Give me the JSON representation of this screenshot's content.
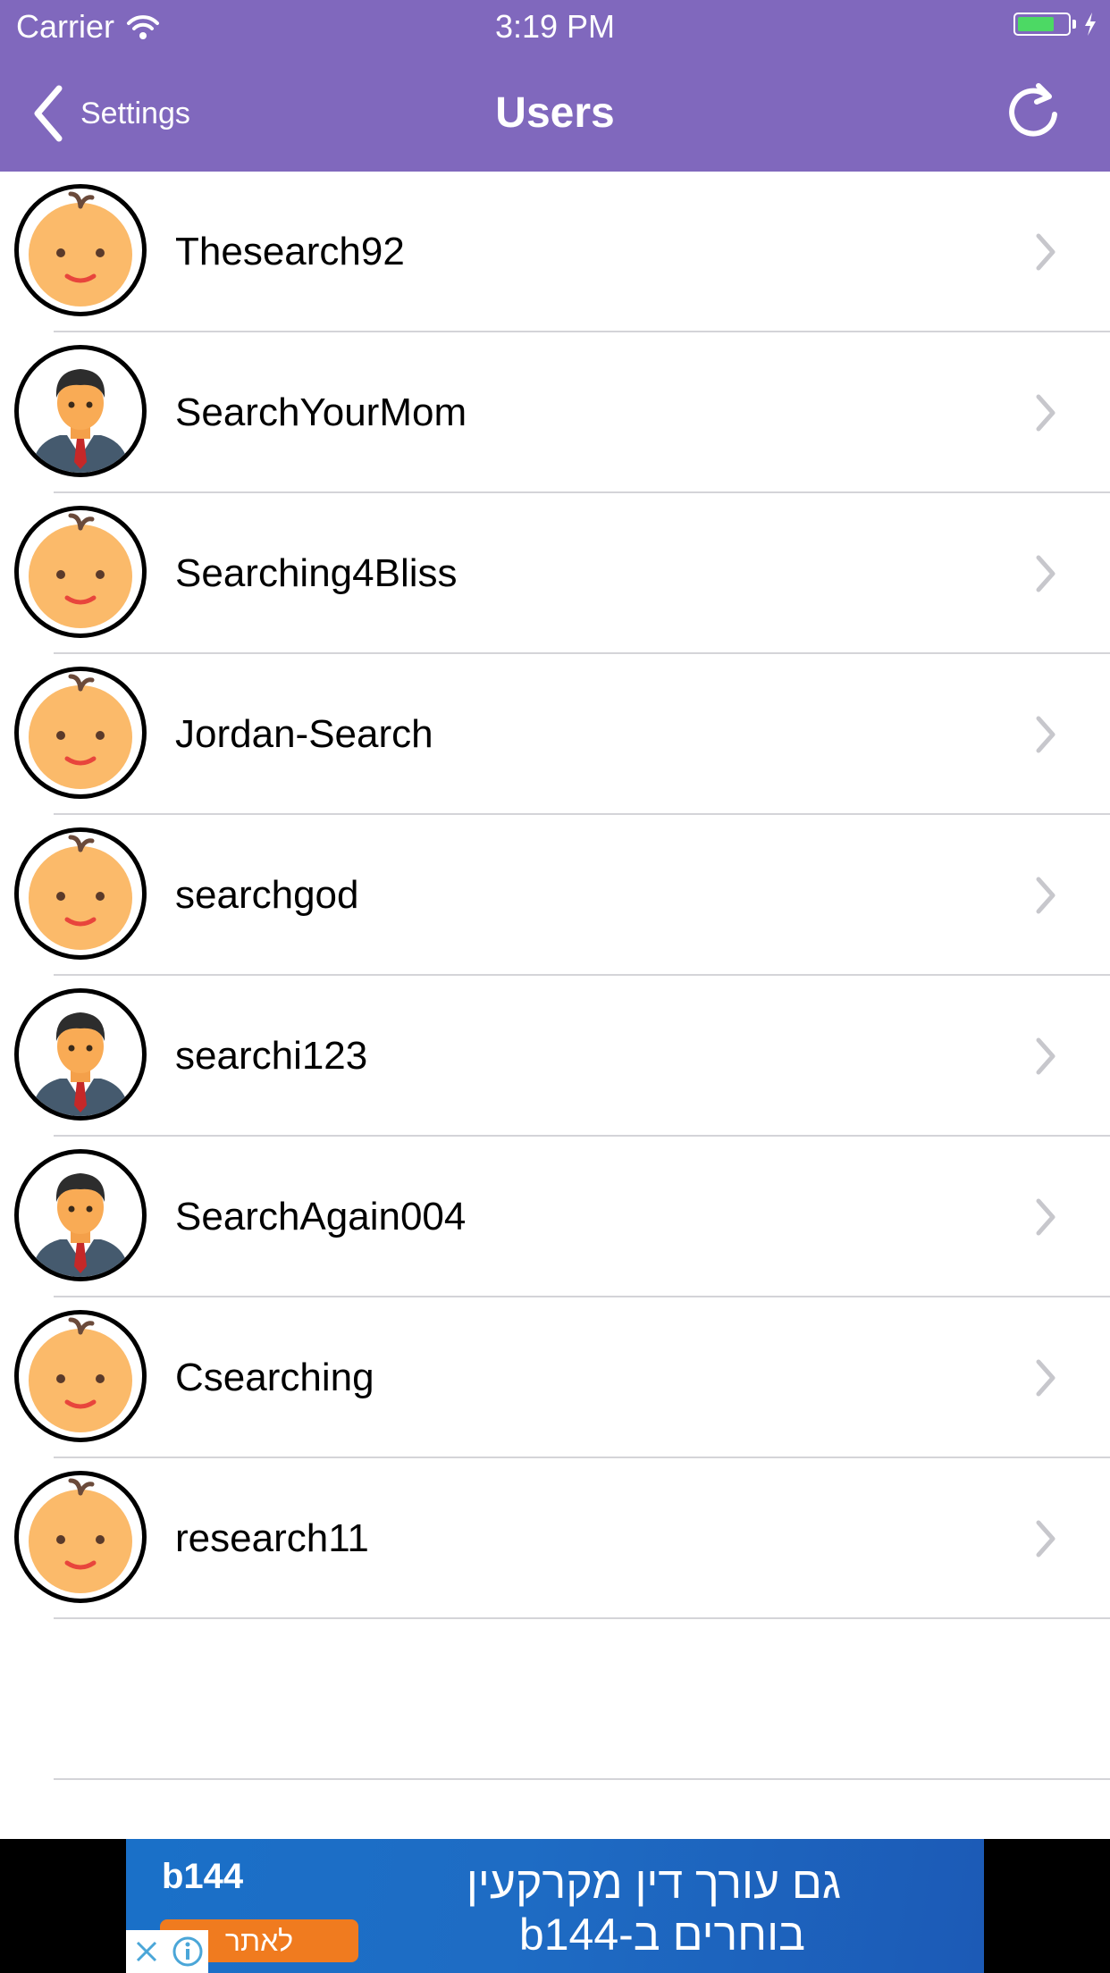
{
  "status_bar": {
    "carrier": "Carrier",
    "time": "3:19 PM",
    "battery_level": 0.66
  },
  "nav": {
    "back_label": "Settings",
    "title": "Users"
  },
  "users": [
    {
      "name": "Thesearch92",
      "avatar": "baby-avatar-icon"
    },
    {
      "name": "SearchYourMom",
      "avatar": "businessman-avatar-icon"
    },
    {
      "name": "Searching4Bliss",
      "avatar": "baby-avatar-icon"
    },
    {
      "name": "Jordan-Search",
      "avatar": "baby-avatar-icon"
    },
    {
      "name": "searchgod",
      "avatar": "baby-avatar-icon"
    },
    {
      "name": "searchi123",
      "avatar": "businessman-avatar-icon"
    },
    {
      "name": "SearchAgain004",
      "avatar": "businessman-avatar-icon"
    },
    {
      "name": "Csearching",
      "avatar": "baby-avatar-icon"
    },
    {
      "name": "research11",
      "avatar": "baby-avatar-icon"
    }
  ],
  "ad": {
    "brand": "b144",
    "cta": "לאתר",
    "line1": "גם עורך דין מקרקעין",
    "line2": "בוחרים ב-b144"
  },
  "colors": {
    "nav_bg": "#8068bd",
    "battery": "#4cd964",
    "ad_cta": "#f07b1f"
  }
}
